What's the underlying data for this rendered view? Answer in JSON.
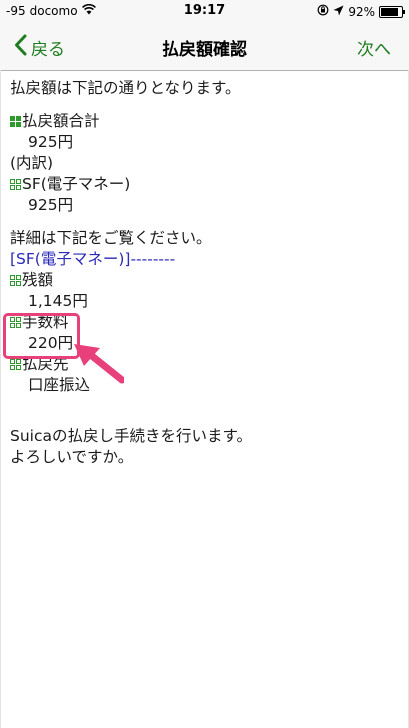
{
  "statusbar": {
    "signal": "-95",
    "carrier": "docomo",
    "time": "19:17",
    "battery_pct": "92%",
    "battery_level": 0.92
  },
  "navbar": {
    "back_label": "戻る",
    "title": "払戻額確認",
    "next_label": "次へ"
  },
  "content": {
    "intro": "払戻額は下記の通りとなります。",
    "total_label": "払戻額合計",
    "total_value": "925円",
    "breakdown_label": "(内訳)",
    "sf_label": "SF(電子マネー)",
    "sf_value": "925円",
    "detail_intro": "詳細は下記をご覧ください。",
    "sf_section_header": "[SF(電子マネー)]--------",
    "balance_label": "残額",
    "balance_value": "1,145円",
    "fee_label": "手数料",
    "fee_value": "220円",
    "destination_label": "払戻先",
    "destination_value": "口座振込",
    "confirm_line1": "Suicaの払戻し手続きを行います。",
    "confirm_line2": "よろしいですか。"
  },
  "colors": {
    "accent_green": "#1e7d1e",
    "icon_green": "#2e9a2e",
    "section_blue": "#2a2ab8",
    "highlight_pink": "#e8407a"
  }
}
